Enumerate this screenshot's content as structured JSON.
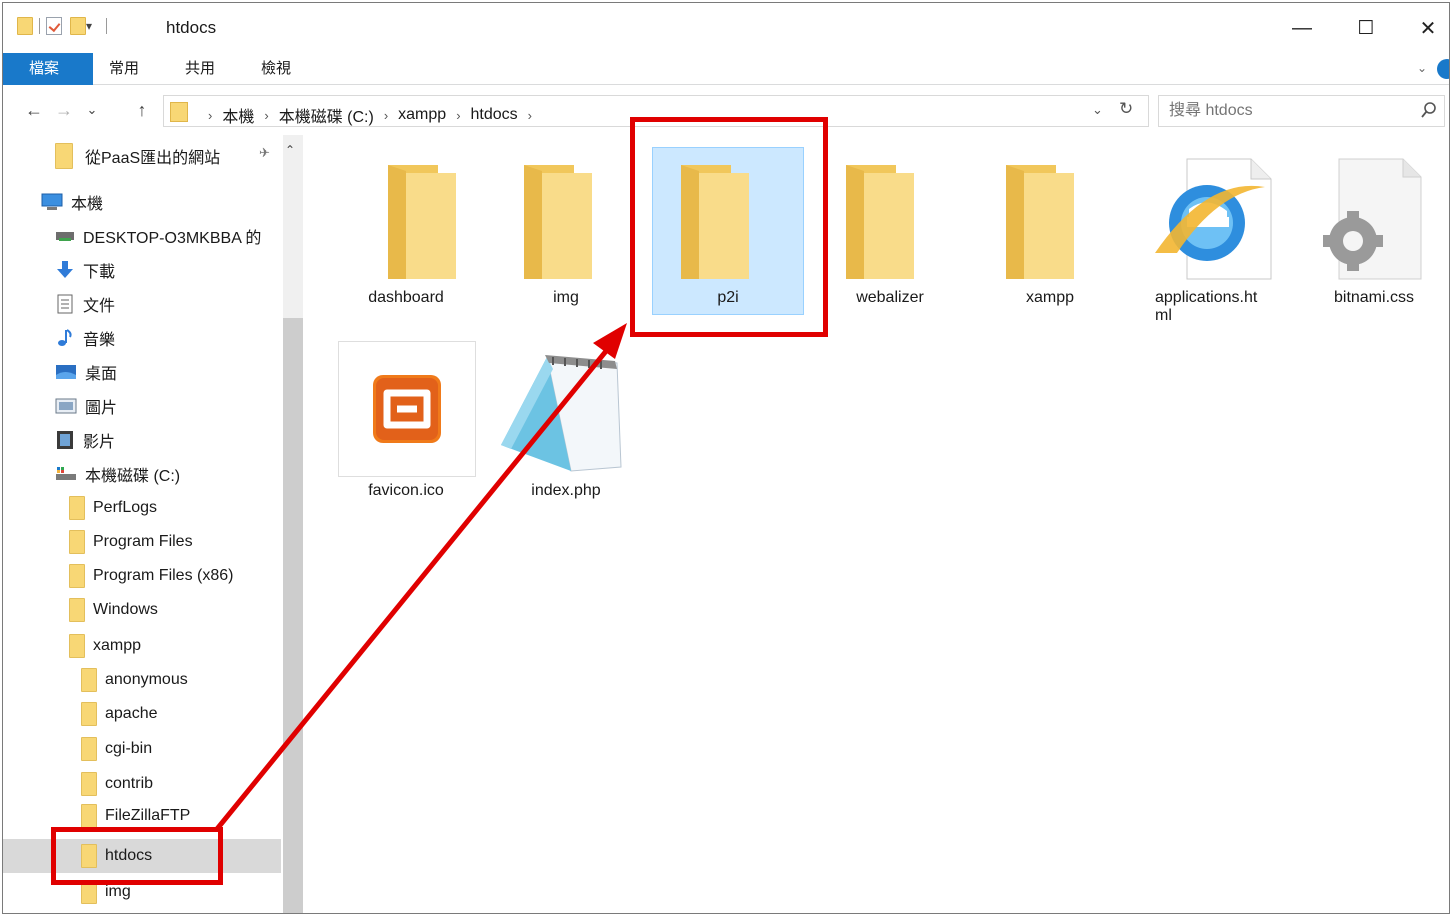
{
  "window": {
    "title": "htdocs",
    "controls": {
      "minimize": "—",
      "maximize": "☐",
      "close": "✕"
    }
  },
  "ribbon": {
    "tabs": [
      "檔案",
      "常用",
      "共用",
      "檢視"
    ],
    "expand": "⌄"
  },
  "navigation": {
    "back": "←",
    "forward": "→",
    "recent": "⌄",
    "up": "↑",
    "breadcrumb": [
      "本機",
      "本機磁碟 (C:)",
      "xampp",
      "htdocs"
    ],
    "separator": "›",
    "dropdown": "⌄",
    "refresh": "↻"
  },
  "search": {
    "placeholder": "搜尋 htdocs"
  },
  "sidebar": {
    "quick_access": "從PaaS匯出的網站",
    "pin": "📌",
    "collapse": "⌃",
    "items": [
      {
        "label": "本機",
        "icon": "computer-icon"
      },
      {
        "label": "DESKTOP-O3MKBBA 的",
        "icon": "network-drive-icon"
      },
      {
        "label": "下載",
        "icon": "download-icon"
      },
      {
        "label": "文件",
        "icon": "document-icon"
      },
      {
        "label": "音樂",
        "icon": "music-icon"
      },
      {
        "label": "桌面",
        "icon": "desktop-icon"
      },
      {
        "label": "圖片",
        "icon": "pictures-icon"
      },
      {
        "label": "影片",
        "icon": "video-icon"
      },
      {
        "label": "本機磁碟 (C:)",
        "icon": "drive-icon"
      },
      {
        "label": "PerfLogs",
        "icon": "folder-icon"
      },
      {
        "label": "Program Files",
        "icon": "folder-icon"
      },
      {
        "label": "Program Files (x86)",
        "icon": "folder-icon"
      },
      {
        "label": "Windows",
        "icon": "folder-icon"
      },
      {
        "label": "xampp",
        "icon": "folder-icon"
      },
      {
        "label": "anonymous",
        "icon": "folder-icon"
      },
      {
        "label": "apache",
        "icon": "folder-icon"
      },
      {
        "label": "cgi-bin",
        "icon": "folder-icon"
      },
      {
        "label": "contrib",
        "icon": "folder-icon"
      },
      {
        "label": "FileZillaFTP",
        "icon": "folder-icon"
      },
      {
        "label": "htdocs",
        "icon": "folder-icon",
        "selected": true
      },
      {
        "label": "img",
        "icon": "folder-icon"
      }
    ]
  },
  "files": [
    {
      "name": "dashboard",
      "type": "folder"
    },
    {
      "name": "img",
      "type": "folder"
    },
    {
      "name": "p2i",
      "type": "folder",
      "selected": true
    },
    {
      "name": "webalizer",
      "type": "folder"
    },
    {
      "name": "xampp",
      "type": "folder"
    },
    {
      "name": "applications.ht\nml",
      "type": "html",
      "icon": "internet-explorer-icon"
    },
    {
      "name": "bitnami.css",
      "type": "css",
      "icon": "settings-file-icon"
    },
    {
      "name": "favicon.ico",
      "type": "ico",
      "icon": "xampp-logo-icon"
    },
    {
      "name": "index.php",
      "type": "php",
      "icon": "notepad-icon"
    }
  ],
  "colors": {
    "accent": "#1979ca",
    "selection": "#cce8ff",
    "folder": "#f8d775",
    "annotation": "#e00000"
  }
}
